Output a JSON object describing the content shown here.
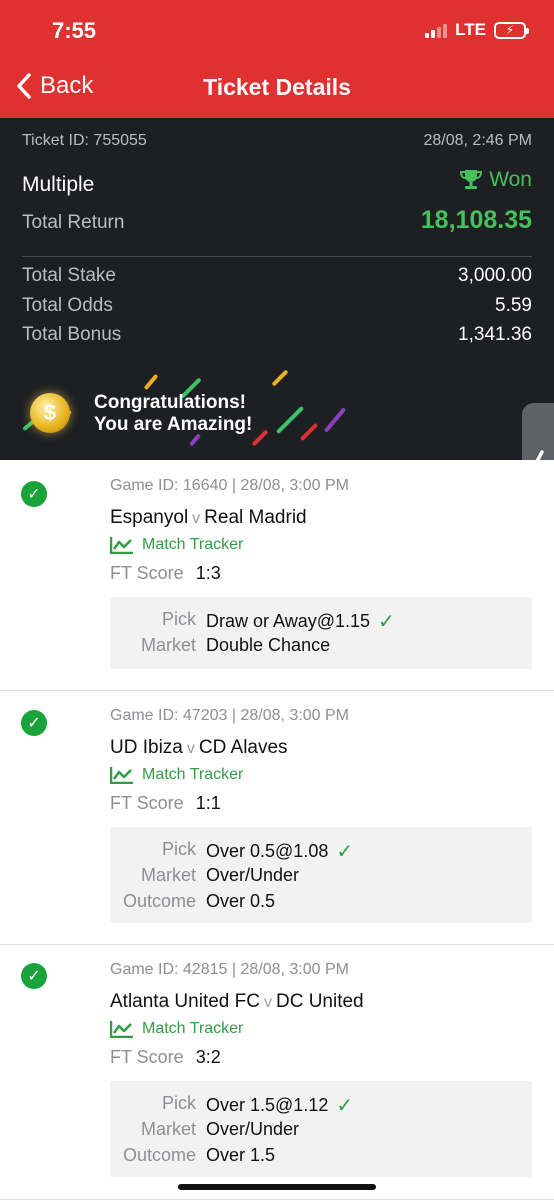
{
  "status_bar": {
    "time": "7:55",
    "network": "LTE"
  },
  "nav": {
    "back_label": "Back",
    "title": "Ticket Details"
  },
  "ticket": {
    "id_label": "Ticket ID: 755055",
    "datetime": "28/08, 2:46 PM",
    "type": "Multiple",
    "status": "Won",
    "return_label": "Total Return",
    "return_value": "18,108.35",
    "stake_label": "Total Stake",
    "stake_value": "3,000.00",
    "odds_label": "Total Odds",
    "odds_value": "5.59",
    "bonus_label": "Total Bonus",
    "bonus_value": "1,341.36"
  },
  "banner": {
    "line1": "Congratulations!",
    "line2": "You are Amazing!",
    "coin_symbol": "$"
  },
  "bets": [
    {
      "game_id": "Game ID: 16640 |  28/08, 3:00 PM",
      "home": "Espanyol",
      "vs": "v",
      "away": "Real Madrid",
      "tracker": "Match Tracker",
      "ft_label": "FT Score",
      "ft_value": "1:3",
      "pick_label": "Pick",
      "pick_value": "Draw or Away@1.15",
      "market_label": "Market",
      "market_value": "Double Chance"
    },
    {
      "game_id": "Game ID: 47203 |  28/08, 3:00 PM",
      "home": "UD Ibiza",
      "vs": "v",
      "away": "CD Alaves",
      "tracker": "Match Tracker",
      "ft_label": "FT Score",
      "ft_value": "1:1",
      "pick_label": "Pick",
      "pick_value": "Over 0.5@1.08",
      "market_label": "Market",
      "market_value": "Over/Under",
      "outcome_label": "Outcome",
      "outcome_value": "Over 0.5"
    },
    {
      "game_id": "Game ID: 42815 |  28/08, 3:00 PM",
      "home": "Atlanta United FC",
      "vs": "v",
      "away": "DC United",
      "tracker": "Match Tracker",
      "ft_label": "FT Score",
      "ft_value": "3:2",
      "pick_label": "Pick",
      "pick_value": "Over 1.5@1.12",
      "market_label": "Market",
      "market_value": "Over/Under",
      "outcome_label": "Outcome",
      "outcome_value": "Over 1.5"
    }
  ],
  "colors": {
    "brand_red": "#e03131",
    "won_green": "#45c15a",
    "dark_bg": "#1d1f23"
  }
}
